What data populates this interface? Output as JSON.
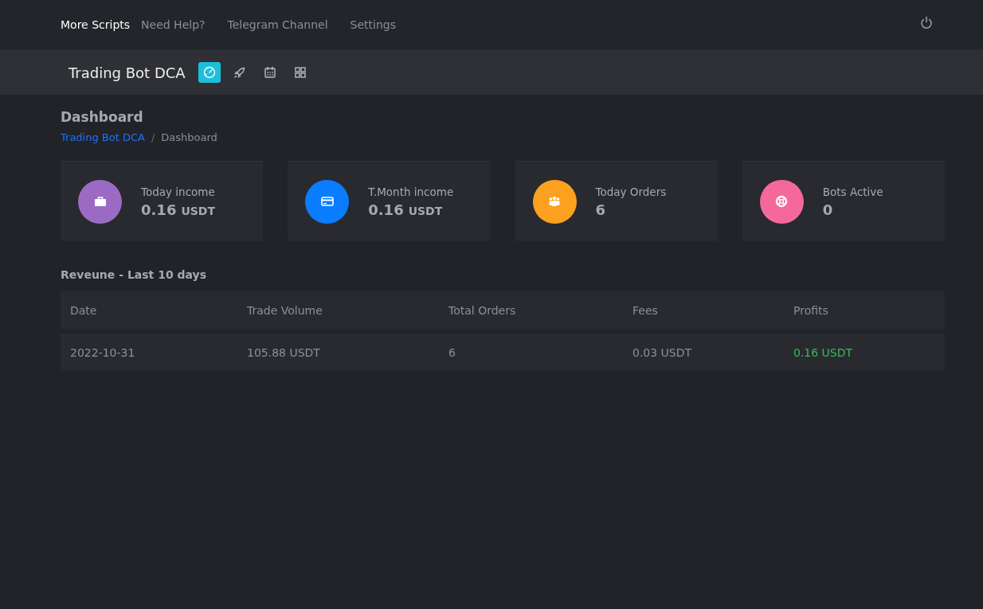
{
  "top_nav": [
    {
      "label": "More Scripts",
      "selected": true
    },
    {
      "label": "Need Help?",
      "selected": false
    },
    {
      "label": "Telegram Channel",
      "selected": false
    },
    {
      "label": "Settings",
      "selected": false
    }
  ],
  "app_bar": {
    "title": "Trading Bot DCA",
    "tools": [
      {
        "selected": true
      },
      {
        "selected": false
      },
      {
        "selected": false
      },
      {
        "selected": false
      }
    ]
  },
  "page": {
    "title": "Dashboard",
    "breadcrumb": [
      "Trading Bot DCA",
      "Dashboard"
    ],
    "breadcrumb_separator": "/"
  },
  "stats": [
    {
      "label": "Today income",
      "value": "0.16",
      "unit": "USDT",
      "color": "#9b6bc4"
    },
    {
      "label": "T.Month income",
      "value": "0.16",
      "unit": "USDT",
      "color": "#0a7cfe"
    },
    {
      "label": "Today Orders",
      "value": "6",
      "color": "#fca11f"
    },
    {
      "label": "Bots Active",
      "value": "0",
      "color": "#f4699a"
    }
  ],
  "revenue": {
    "title": "Reveune - Last 10 days",
    "columns": [
      "Date",
      "Trade Volume",
      "Total Orders",
      "Fees",
      "Profits"
    ],
    "rows": [
      [
        "2022-10-31",
        "105.88 USDT",
        "6",
        "0.03 USDT",
        "0.16 USDT"
      ]
    ]
  }
}
